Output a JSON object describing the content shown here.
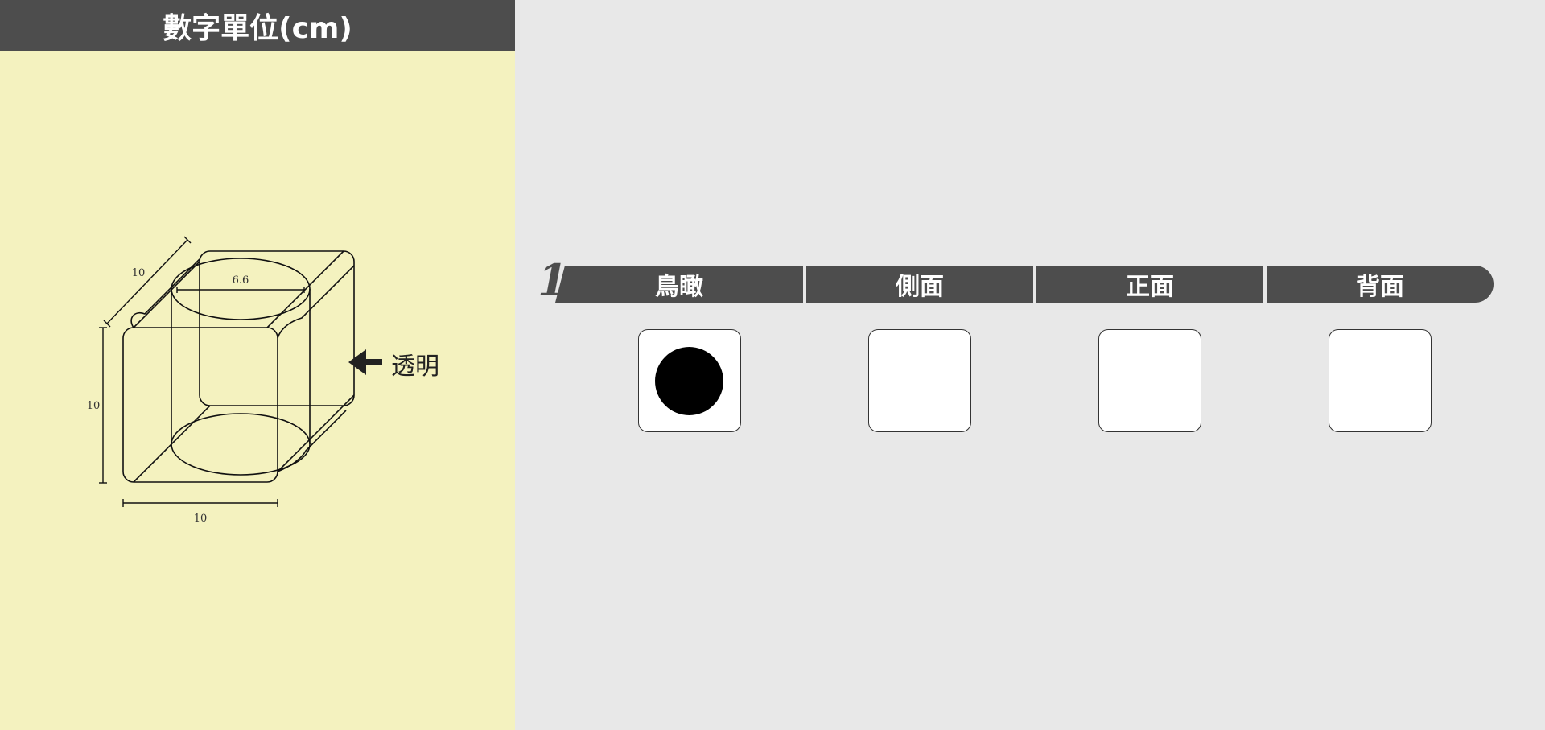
{
  "header": {
    "title": "數字單位(cm)"
  },
  "figure": {
    "depth_label": "10",
    "diameter_label": "6.6",
    "height_label": "10",
    "width_label": "10",
    "transparent_label": "透明"
  },
  "question": {
    "number": "1"
  },
  "tabs": [
    {
      "label": "鳥瞰"
    },
    {
      "label": "側面"
    },
    {
      "label": "正面"
    },
    {
      "label": "背面"
    }
  ],
  "answers": [
    {
      "view": "鳥瞰",
      "filled_circle": true
    },
    {
      "view": "側面",
      "filled_circle": false
    },
    {
      "view": "正面",
      "filled_circle": false
    },
    {
      "view": "背面",
      "filled_circle": false
    }
  ],
  "colors": {
    "header_bg": "#4d4d4d",
    "left_bg": "#f4f2bf",
    "right_bg": "#e8e8e8"
  }
}
